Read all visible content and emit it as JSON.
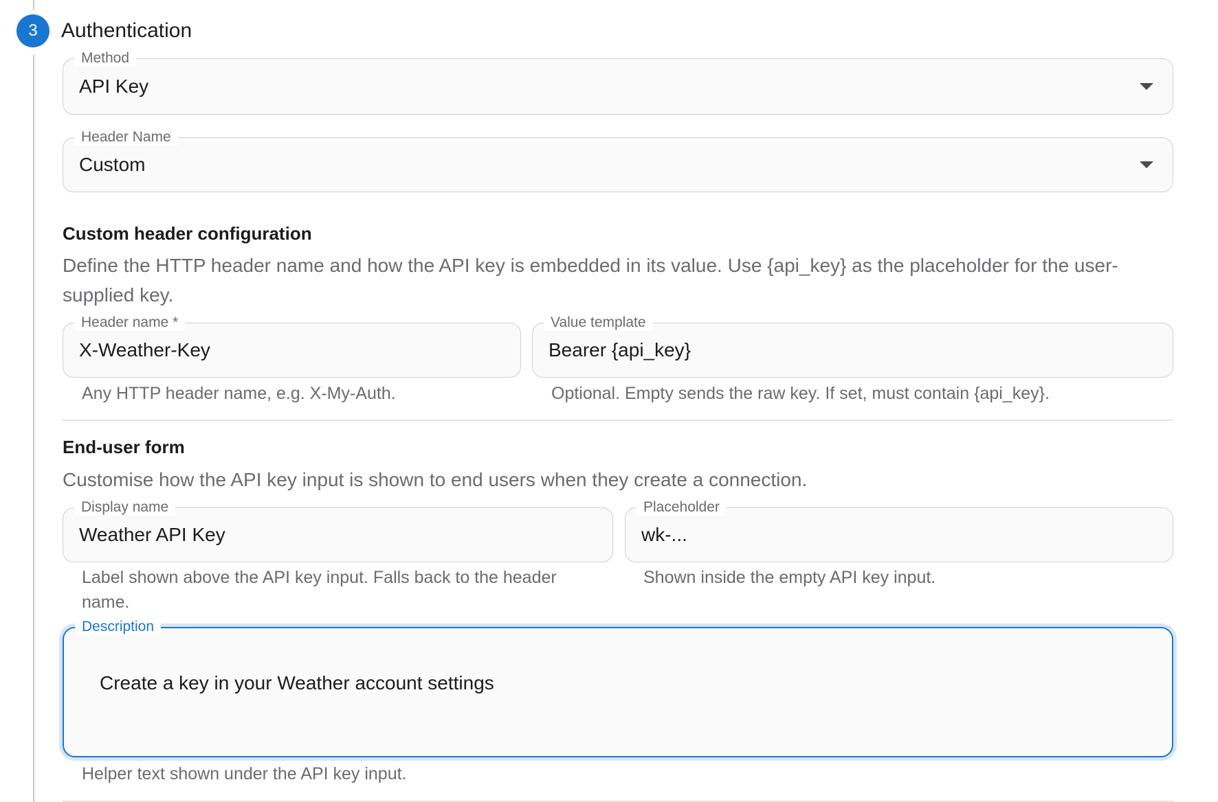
{
  "step": {
    "number": "3",
    "title": "Authentication"
  },
  "method": {
    "label": "Method",
    "value": "API Key"
  },
  "header_name_select": {
    "label": "Header Name",
    "value": "Custom"
  },
  "custom_header": {
    "title": "Custom header configuration",
    "description": "Define the HTTP header name and how the API key is embedded in its value. Use {api_key} as the placeholder for the user-supplied key.",
    "header_name": {
      "label": "Header name *",
      "value": "X-Weather-Key",
      "helper": "Any HTTP header name, e.g. X-My-Auth."
    },
    "value_template": {
      "label": "Value template",
      "value": "Bearer {api_key}",
      "helper": "Optional. Empty sends the raw key. If set, must contain {api_key}."
    }
  },
  "end_user_form": {
    "title": "End-user form",
    "description": "Customise how the API key input is shown to end users when they create a connection.",
    "display_name": {
      "label": "Display name",
      "value": "Weather API Key",
      "helper": "Label shown above the API key input. Falls back to the header name."
    },
    "placeholder": {
      "label": "Placeholder",
      "value": "wk-...",
      "helper": "Shown inside the empty API key input."
    },
    "description_field": {
      "label": "Description",
      "value": "Create a key in your Weather account settings",
      "helper": "Helper text shown under the API key input."
    }
  },
  "colors": {
    "accent": "#1976d2",
    "border": "#cfcfd2",
    "muted_text": "#6b6b70"
  }
}
